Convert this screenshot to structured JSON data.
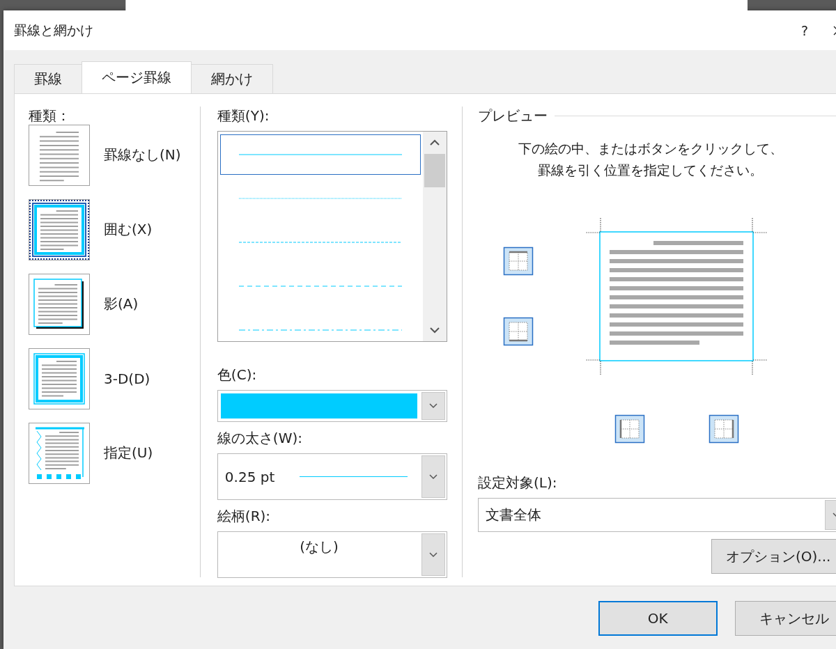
{
  "window": {
    "title": "罫線と網かけ",
    "help": "?"
  },
  "tabs": [
    {
      "label": "罫線",
      "selected": false
    },
    {
      "label": "ページ罫線",
      "selected": true
    },
    {
      "label": "網かけ",
      "selected": false
    }
  ],
  "setting": {
    "label": "種類：",
    "options": [
      {
        "kind": "none",
        "label": "罫線なし(N)",
        "selected": false
      },
      {
        "kind": "box",
        "label": "囲む(X)",
        "selected": true
      },
      {
        "kind": "shadow",
        "label": "影(A)",
        "selected": false
      },
      {
        "kind": "threed",
        "label": "3-D(D)",
        "selected": false
      },
      {
        "kind": "custom",
        "label": "指定(U)",
        "selected": false
      }
    ]
  },
  "style": {
    "label": "種類(Y):",
    "items": [
      {
        "kind": "solid",
        "selected": true
      },
      {
        "kind": "dotted",
        "selected": false
      },
      {
        "kind": "dashed-small",
        "selected": false
      },
      {
        "kind": "dashed",
        "selected": false
      },
      {
        "kind": "dash-dot",
        "selected": false
      }
    ]
  },
  "color": {
    "label": "色(C):",
    "color": "#00ccff"
  },
  "width": {
    "label": "線の太さ(W):",
    "value": "0.25 pt"
  },
  "art": {
    "label": "絵柄(R):",
    "value": "(なし)"
  },
  "preview": {
    "title": "プレビュー",
    "instructions": [
      "下の絵の中、またはボタンをクリックして、",
      "罫線を引く位置を指定してください。"
    ],
    "edge_buttons": [
      {
        "kind": "top",
        "on": true
      },
      {
        "kind": "bottom",
        "on": true
      },
      {
        "kind": "left",
        "on": true
      },
      {
        "kind": "right",
        "on": true
      }
    ]
  },
  "apply_to": {
    "label": "設定対象(L):",
    "value": "文書全体"
  },
  "options_button": "オプション(O)...",
  "buttons": [
    {
      "label": "OK",
      "default": true
    },
    {
      "label": "キャンセル",
      "default": false
    }
  ]
}
